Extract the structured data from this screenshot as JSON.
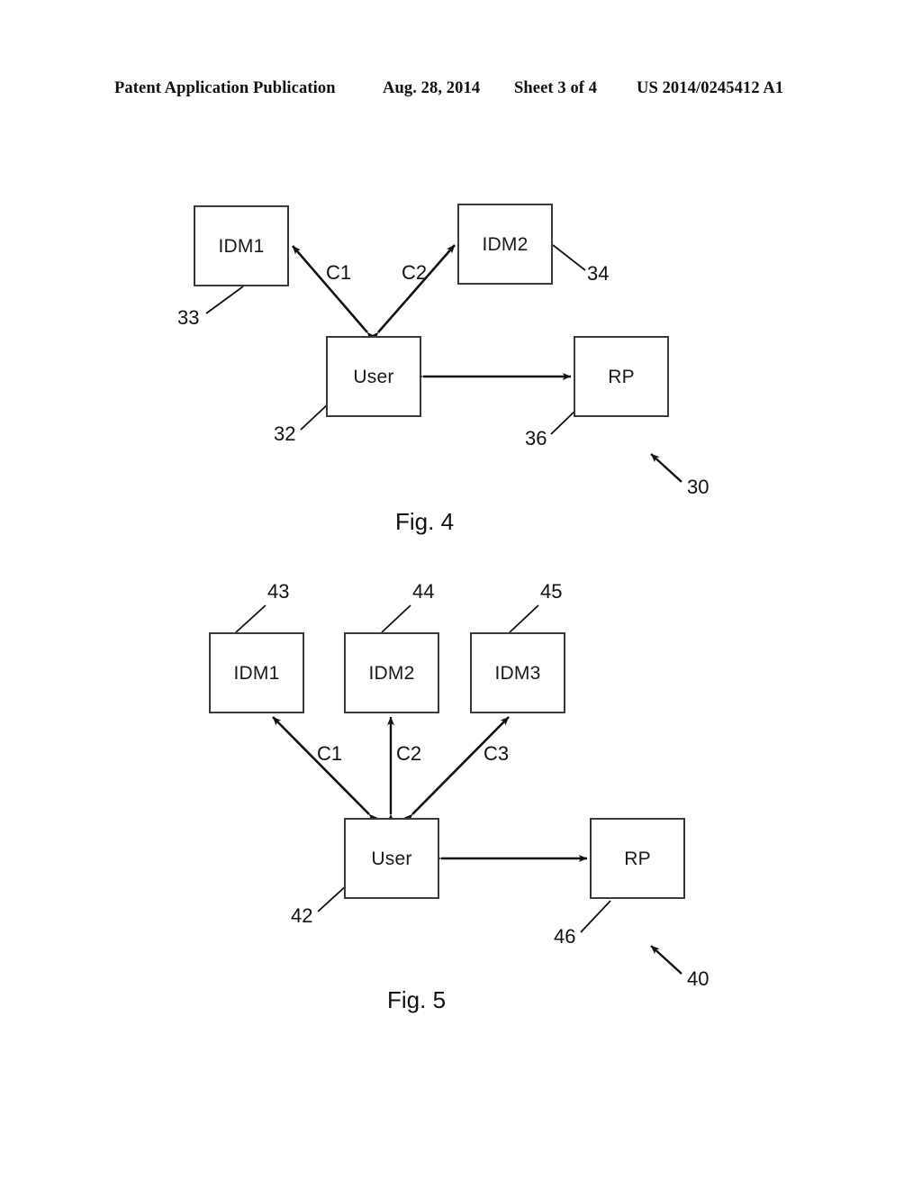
{
  "header": {
    "publication": "Patent Application Publication",
    "date": "Aug. 28, 2014",
    "sheet": "Sheet 3 of 4",
    "doc_number": "US 2014/0245412 A1"
  },
  "figures": [
    {
      "caption": "Fig. 4",
      "system_ref": "30",
      "nodes": [
        {
          "id": "idm1",
          "label": "IDM1",
          "ref": "33"
        },
        {
          "id": "idm2",
          "label": "IDM2",
          "ref": "34"
        },
        {
          "id": "user",
          "label": "User",
          "ref": "32"
        },
        {
          "id": "rp",
          "label": "RP",
          "ref": "36"
        }
      ],
      "links": [
        {
          "label": "C1",
          "from": "user",
          "to": "idm1"
        },
        {
          "label": "C2",
          "from": "user",
          "to": "idm2"
        },
        {
          "label": "",
          "from": "user",
          "to": "rp"
        }
      ]
    },
    {
      "caption": "Fig. 5",
      "system_ref": "40",
      "nodes": [
        {
          "id": "idm1",
          "label": "IDM1",
          "ref": "43"
        },
        {
          "id": "idm2",
          "label": "IDM2",
          "ref": "44"
        },
        {
          "id": "idm3",
          "label": "IDM3",
          "ref": "45"
        },
        {
          "id": "user",
          "label": "User",
          "ref": "42"
        },
        {
          "id": "rp",
          "label": "RP",
          "ref": "46"
        }
      ],
      "links": [
        {
          "label": "C1",
          "from": "user",
          "to": "idm1"
        },
        {
          "label": "C2",
          "from": "user",
          "to": "idm2"
        },
        {
          "label": "C3",
          "from": "user",
          "to": "idm3"
        },
        {
          "label": "",
          "from": "user",
          "to": "rp"
        }
      ]
    }
  ],
  "colors": {
    "ink": "#111111",
    "box_stroke": "#3a3a3a",
    "page_background": "#ffffff"
  }
}
